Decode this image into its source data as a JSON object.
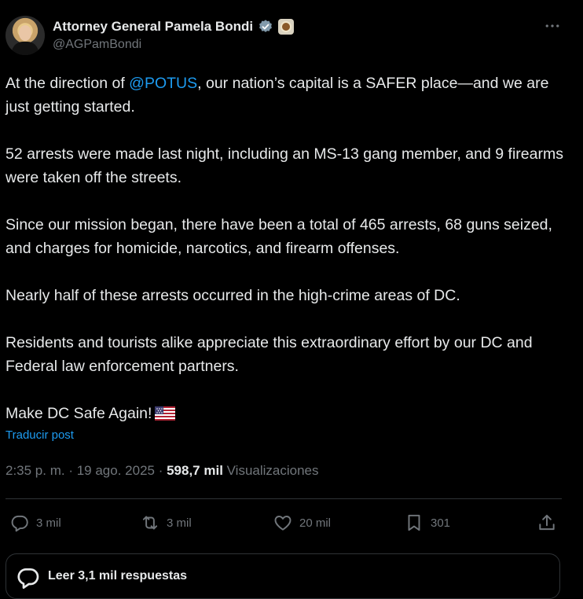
{
  "author": {
    "name": "Attorney General Pamela Bondi",
    "handle": "@AGPamBondi",
    "verified_icon": "verified-badge-icon",
    "affiliation_icon": "doj-seal-icon"
  },
  "post": {
    "line1_prefix": "At the direction of ",
    "mention": "@POTUS",
    "line1_suffix": ", our nation’s capital is a SAFER place—and we are just getting started.",
    "para2": "52 arrests were made last night, including an MS-13 gang member, and 9 firearms were taken off the streets.",
    "para3": "Since our mission began, there have been a total of 465 arrests, 68 guns seized, and charges for homicide, narcotics, and firearm offenses.",
    "para4": "Nearly half of these arrests occurred in the high-crime areas of DC.",
    "para5": "Residents and tourists alike appreciate this extraordinary effort by our DC and Federal law enforcement partners.",
    "para6": "Make DC Safe Again!",
    "flag_icon": "us-flag-icon"
  },
  "translate_label": "Traducir post",
  "meta": {
    "time": "2:35 p. m.",
    "sep1": " · ",
    "date": "19 ago. 2025",
    "sep2": " · ",
    "views_count": "598,7 mil",
    "views_label": " Visualizaciones"
  },
  "actions": {
    "replies": "3 mil",
    "reposts": "3 mil",
    "likes": "20 mil",
    "bookmarks": "301"
  },
  "replies_bar_label": "Leer 3,1 mil respuestas",
  "colors": {
    "background": "#000000",
    "text": "#e7e9ea",
    "muted": "#71767b",
    "accent": "#1d9bf0",
    "border": "#2f3336"
  }
}
